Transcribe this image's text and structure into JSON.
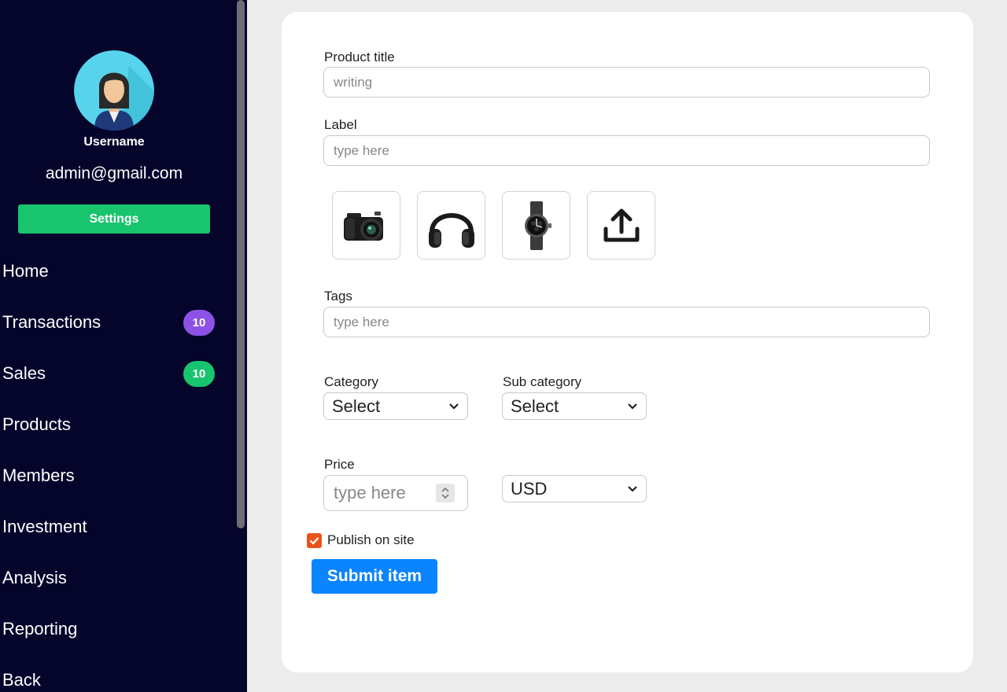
{
  "sidebar": {
    "username": "Username",
    "email": "admin@gmail.com",
    "settings_label": "Settings",
    "nav": [
      {
        "label": "Home"
      },
      {
        "label": "Transactions",
        "badge": "10",
        "badge_color": "#8c52e6"
      },
      {
        "label": "Sales",
        "badge": "10",
        "badge_color": "#19c46e"
      },
      {
        "label": "Products"
      },
      {
        "label": "Members"
      },
      {
        "label": "Investment"
      },
      {
        "label": "Analysis"
      },
      {
        "label": "Reporting"
      },
      {
        "label": "Back"
      }
    ]
  },
  "form": {
    "product_title": {
      "label": "Product title",
      "placeholder": "writing"
    },
    "label_field": {
      "label": "Label",
      "placeholder": "type here"
    },
    "images": [
      "camera-icon",
      "headphones-icon",
      "watch-icon",
      "upload-icon"
    ],
    "tags": {
      "label": "Tags",
      "placeholder": "type here"
    },
    "category": {
      "label": "Category",
      "value": "Select"
    },
    "sub_category": {
      "label": "Sub category",
      "value": "Select"
    },
    "price": {
      "label": "Price",
      "placeholder": "type here"
    },
    "currency": {
      "value": "USD"
    },
    "publish": {
      "label": "Publish on site",
      "checked": true
    },
    "submit_label": "Submit item"
  },
  "colors": {
    "sidebar_bg": "#05042b",
    "settings_green": "#19c46e",
    "badge_purple": "#8c52e6",
    "badge_green": "#19c46e",
    "submit_blue": "#0a84ff",
    "checkbox_orange": "#e8541c"
  }
}
